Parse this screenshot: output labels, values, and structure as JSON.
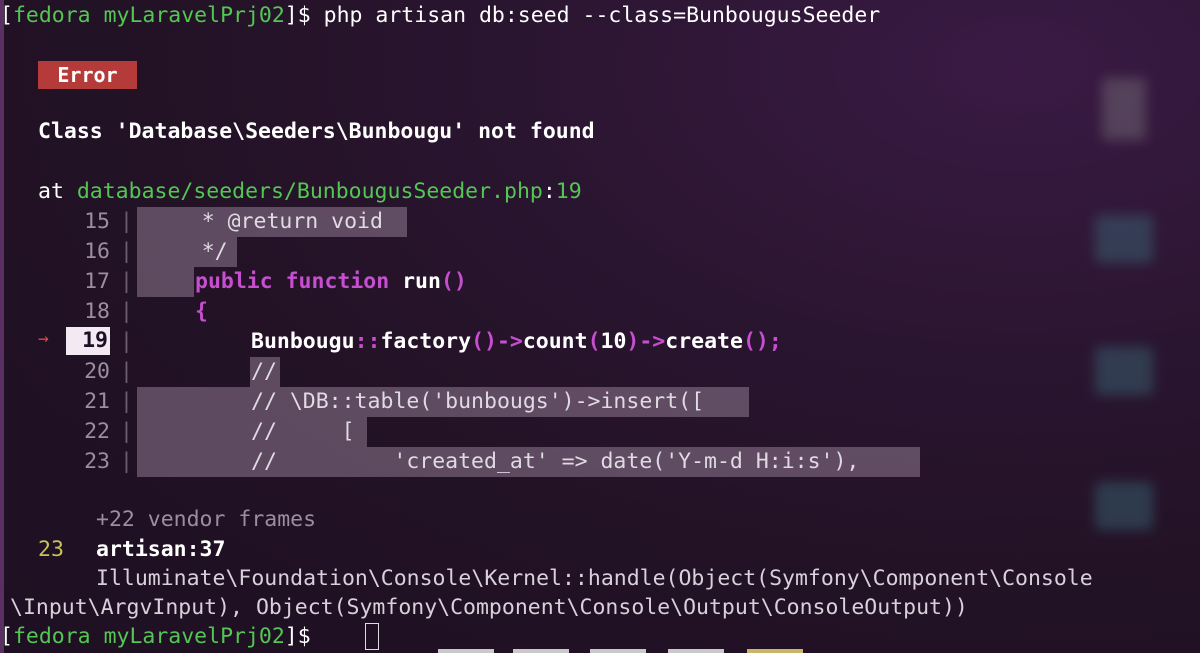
{
  "terminal": {
    "prompt_host": "fedora",
    "prompt_dir": "myLaravelPrj02",
    "command": "php artisan db:seed --class=BunbougusSeeder",
    "error_badge": "Error",
    "error_message": "Class 'Database\\Seeders\\Bunbougu' not found",
    "at_label": "at",
    "file_path": "database/seeders/BunbougusSeeder.php",
    "file_line": "19",
    "code_lines": [
      {
        "num": "15",
        "text": "     * @return void"
      },
      {
        "num": "16",
        "text": "     */"
      },
      {
        "num": "17",
        "kw1": "public function",
        "rest": " run",
        "paren": "()"
      },
      {
        "num": "18",
        "text": "{"
      },
      {
        "num": "19",
        "c1": "Bunbougu",
        "c2": "::",
        "c3": "factory",
        "c4": "()->",
        "c5": "count",
        "c6": "(",
        "c7": "10",
        "c8": ")->",
        "c9": "create",
        "c10": "();"
      },
      {
        "num": "20",
        "text": "//"
      },
      {
        "num": "21",
        "text": "// \\DB::table('bunbougs')->insert(["
      },
      {
        "num": "22",
        "text": "//     ["
      },
      {
        "num": "23",
        "text": "//         'created_at' => date('Y-m-d H:i:s'),"
      }
    ],
    "vendor_frames": "+22 vendor frames",
    "frame_number": "23",
    "frame_location": "artisan:37",
    "frame_call_1": "Illuminate\\Foundation\\Console\\Kernel::handle(Object(Symfony\\Component\\Console",
    "frame_call_2": "\\Input\\ArgvInput), Object(Symfony\\Component\\Console\\Output\\ConsoleOutput))"
  },
  "colors": {
    "prompt_green": "#53c653",
    "error_red": "#b53a3a",
    "keyword_purple": "#c64fd0",
    "line_number_yellow": "#c9c25a"
  }
}
